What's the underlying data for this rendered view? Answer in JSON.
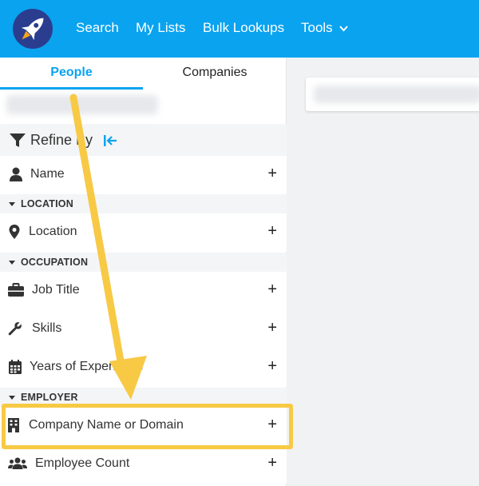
{
  "nav": {
    "items": [
      "Search",
      "My Lists",
      "Bulk Lookups",
      "Tools"
    ]
  },
  "tabs": {
    "people": "People",
    "companies": "Companies"
  },
  "refine": {
    "label": "Refine By"
  },
  "filters": {
    "name": "Name",
    "location_section": "LOCATION",
    "location": "Location",
    "occupation_section": "OCCUPATION",
    "job_title": "Job Title",
    "skills": "Skills",
    "years_experience": "Years of Experience",
    "employer_section": "EMPLOYER",
    "company": "Company Name or Domain",
    "employee_count": "Employee Count",
    "plus": "+"
  },
  "colors": {
    "brand": "#0aa3f0",
    "logo_bg": "#2a3d8f",
    "annotation": "#f7c945"
  },
  "icons": [
    "rocket-logo",
    "chevron-down-icon",
    "filter-icon",
    "collapse-icon",
    "person-icon",
    "map-pin-icon",
    "briefcase-icon",
    "wrench-icon",
    "calendar-icon",
    "building-icon",
    "users-icon"
  ]
}
